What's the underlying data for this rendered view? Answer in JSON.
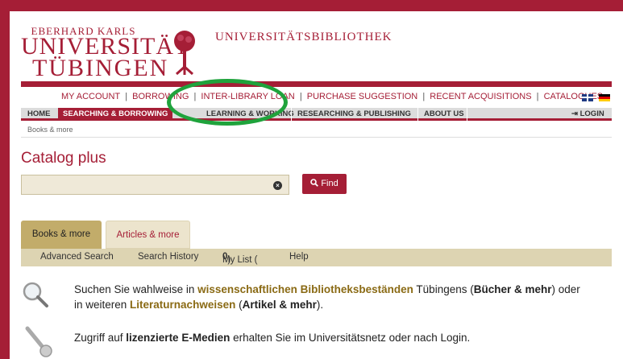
{
  "header": {
    "uni_small": "EBERHARD KARLS",
    "uni_big": "UNIVERSITÄT",
    "uni_big2": "TÜBINGEN",
    "library_title": "UNIVERSITÄTSBIBLIOTHEK"
  },
  "toplinks": {
    "items": [
      "MY ACCOUNT",
      "BORROWING",
      "INTER-LIBRARY LOAN",
      "PURCHASE SUGGESTION",
      "RECENT ACQUISITIONS",
      "CATALOGUES"
    ],
    "separator": "|"
  },
  "mainnav": {
    "home": "HOME",
    "searching": "SEARCHING & BORROWING",
    "learning": "LEARNING & WORKING",
    "researching": "RESEARCHING & PUBLISHING",
    "about": "ABOUT US",
    "login": "LOGIN"
  },
  "breadcrumb": "Books & more",
  "catalog": {
    "title": "Catalog plus",
    "search_value": "",
    "clear_icon": "×",
    "find_label": "Find"
  },
  "tabs": {
    "books": "Books & more",
    "articles": "Articles & more"
  },
  "subnav": {
    "advanced": "Advanced Search",
    "history": "Search History",
    "mylist_label": "My List (",
    "mylist_count": "0",
    "mylist_close": ")",
    "help": "Help"
  },
  "info1": {
    "t1": "Suchen Sie wahlweise in ",
    "h1": "wissenschaftlichen Bibliotheksbeständen",
    "t2": " Tübingens (",
    "b1": "Bücher & mehr",
    "t3": ") oder in weiteren ",
    "h2": "Literaturnachweisen",
    "t4": " (",
    "b2": "Artikel & mehr",
    "t5": ")."
  },
  "info2": {
    "t1": "Zugriff auf ",
    "b1": "lizenzierte E-Medien",
    "t2": " erhalten Sie im Universitätsnetz oder nach Login."
  },
  "colors": {
    "brand": "#a51e36",
    "tab_active": "#c2ac6a",
    "highlight_ring": "#1fa33c"
  }
}
